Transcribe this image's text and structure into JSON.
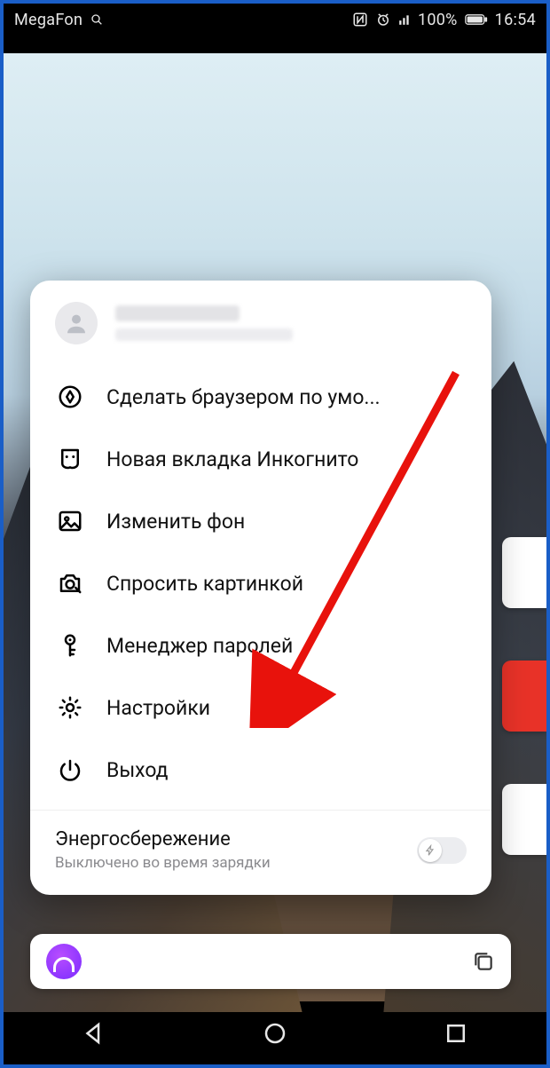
{
  "statusbar": {
    "carrier": "MegaFon",
    "battery_pct": "100%",
    "time": "16:54"
  },
  "profile": {
    "name_line1": "████████",
    "name_line2": "███████████████"
  },
  "menu": {
    "items": [
      {
        "icon": "browser-icon",
        "label": "Сделать браузером по умо..."
      },
      {
        "icon": "incognito-icon",
        "label": "Новая вкладка Инкогнито"
      },
      {
        "icon": "image-icon",
        "label": "Изменить фон"
      },
      {
        "icon": "camera-icon",
        "label": "Спросить картинкой"
      },
      {
        "icon": "key-icon",
        "label": "Менеджер паролей"
      },
      {
        "icon": "gear-icon",
        "label": "Настройки"
      },
      {
        "icon": "power-icon",
        "label": "Выход"
      }
    ]
  },
  "energy": {
    "title": "Энергосбережение",
    "subtitle": "Выключено во время зарядки",
    "enabled": false
  }
}
